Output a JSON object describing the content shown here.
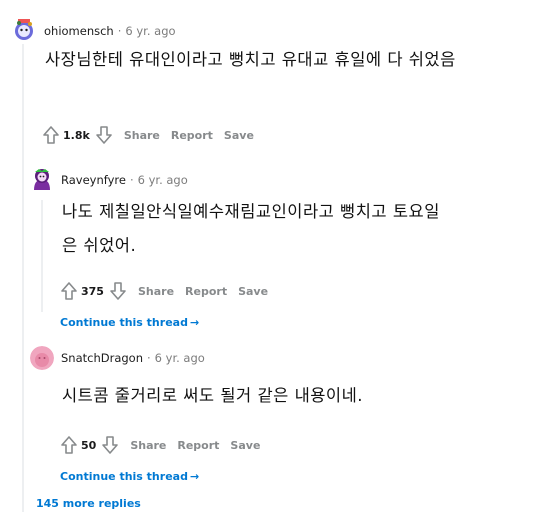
{
  "comments": [
    {
      "author": "ohiomensch",
      "age": "6 yr. ago",
      "body": "사장님한테 유대인이라고 뻥치고 유대교 휴일에 다 쉬었음",
      "score": "1.8k",
      "share": "Share",
      "report": "Report",
      "save": "Save"
    },
    {
      "author": "Raveynfyre",
      "age": "6 yr. ago",
      "body_line1": "나도 제칠일안식일예수재림교인이라고 뻥치고 토요일",
      "body_line2": "은 쉬었어.",
      "score": "375",
      "share": "Share",
      "report": "Report",
      "save": "Save",
      "continue": "Continue this thread"
    },
    {
      "author": "SnatchDragon",
      "age": "6 yr. ago",
      "body": "시트콤 줄거리로 써도 될거 같은 내용이네.",
      "score": "50",
      "share": "Share",
      "report": "Report",
      "save": "Save",
      "continue": "Continue this thread"
    }
  ],
  "more_replies": "145 more replies",
  "colors": {
    "link": "#0079d3",
    "meta": "#7c7c7c",
    "line": "#edeff1"
  },
  "icons": {
    "upvote": "arrow-up-icon",
    "downvote": "arrow-down-icon",
    "continue": "arrow-right-icon"
  }
}
